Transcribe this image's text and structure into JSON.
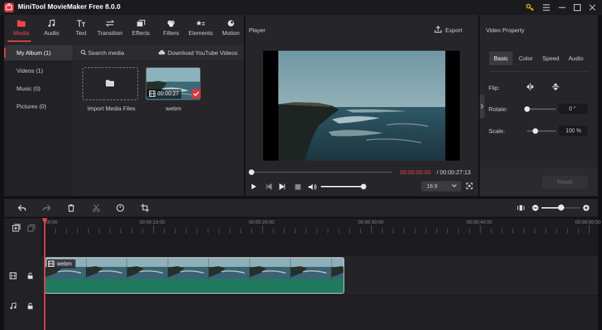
{
  "titlebar": {
    "title": "MiniTool MovieMaker Free 8.0.0"
  },
  "media_tabs": [
    {
      "label": "Media",
      "icon": "folder-icon"
    },
    {
      "label": "Audio",
      "icon": "music-note-icon"
    },
    {
      "label": "Text",
      "icon": "text-icon"
    },
    {
      "label": "Transition",
      "icon": "transition-icon"
    },
    {
      "label": "Effects",
      "icon": "effects-icon"
    },
    {
      "label": "Filters",
      "icon": "filters-icon"
    },
    {
      "label": "Elements",
      "icon": "elements-icon"
    },
    {
      "label": "Motion",
      "icon": "motion-icon"
    }
  ],
  "sidebar": {
    "items": [
      {
        "label": "My Album (1)"
      },
      {
        "label": "Videos (1)"
      },
      {
        "label": "Music (0)"
      },
      {
        "label": "Pictures (0)"
      }
    ]
  },
  "media_panel": {
    "search_label": "Search media",
    "download_label": "Download YouTube Videos",
    "import_label": "Import Media Files",
    "clip": {
      "duration": "00:00:27",
      "name": "webm"
    }
  },
  "player": {
    "title": "Player",
    "export_label": "Export",
    "current_time": "00:00:00:00",
    "separator": " / ",
    "total_time": "00:00:27:13",
    "aspect_ratio": "16:9",
    "progress_fraction": 0.0,
    "volume_fraction": 1.0
  },
  "properties": {
    "title": "Video Property",
    "tabs": [
      {
        "label": "Basic"
      },
      {
        "label": "Color"
      },
      {
        "label": "Speed"
      },
      {
        "label": "Audio"
      }
    ],
    "flip_label": "Flip:",
    "rotate_label": "Rotate:",
    "rotate_value": "0 °",
    "scale_label": "Scale:",
    "scale_value": "100 %",
    "reset_label": "Reset"
  },
  "timeline": {
    "ruler_labels": [
      "00:00",
      "00:00:10:00",
      "00:00:20:00",
      "00:00:30:00",
      "00:00:40:00",
      "00:00:50:00"
    ],
    "clip_label": "webm",
    "zoom_fraction": 0.5
  },
  "colors": {
    "accent": "#ee4444",
    "clip_green": "#1f7a5e",
    "panel": "#26262a"
  }
}
